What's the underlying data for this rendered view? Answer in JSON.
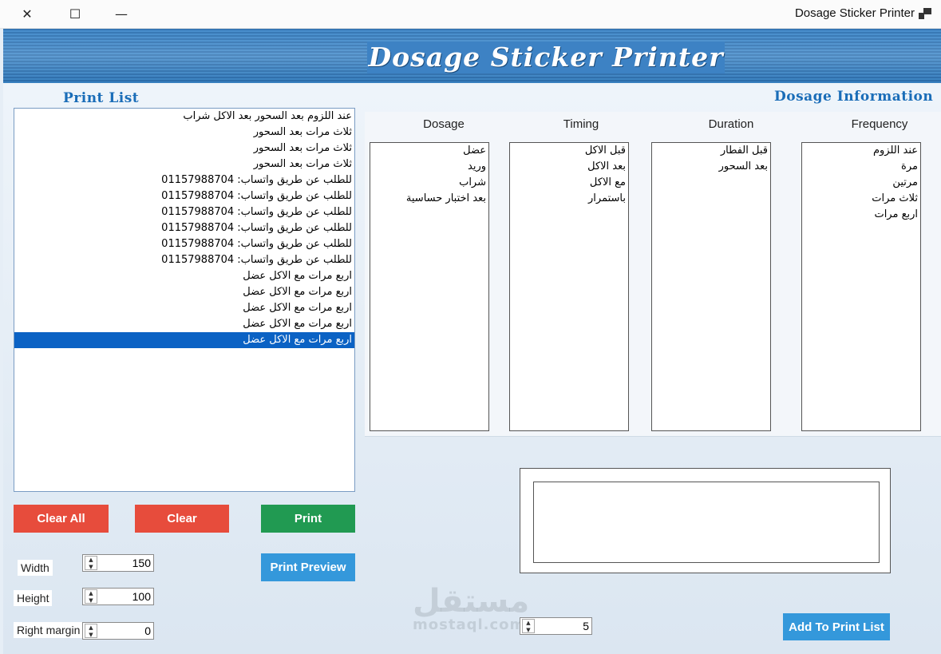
{
  "window": {
    "title": "Dosage Sticker Printer",
    "close_glyph": "✕",
    "maximize_glyph": "☐",
    "minimize_glyph": "—"
  },
  "banner": {
    "title": "Dosage Sticker Printer"
  },
  "print_list": {
    "title": "Print List",
    "items": [
      "عند اللزوم بعد السحور بعد الاكل  شراب",
      "ثلاث مرات بعد السحور",
      "ثلاث مرات بعد السحور",
      "ثلاث مرات بعد السحور",
      "للطلب عن طريق واتساب: 01157988704",
      "للطلب عن طريق واتساب: 01157988704",
      "للطلب عن طريق واتساب: 01157988704",
      "للطلب عن طريق واتساب: 01157988704",
      "للطلب عن طريق واتساب: 01157988704",
      "للطلب عن طريق واتساب: 01157988704",
      "اربع مرات مع الاكل  عضل",
      "اربع مرات مع الاكل  عضل",
      "اربع مرات مع الاكل  عضل",
      "اربع مرات مع الاكل  عضل",
      "اربع مرات مع الاكل  عضل"
    ],
    "selected_index": 14
  },
  "dosage_info": {
    "title": "Dosage Information",
    "columns": {
      "dosage": {
        "header": "Dosage",
        "items": [
          "عضل",
          "وريد",
          "شراب",
          "بعد اختبار حساسية"
        ]
      },
      "timing": {
        "header": "Timing",
        "items": [
          "قبل الاكل",
          "بعد الاكل",
          "مع الاكل",
          "باستمرار"
        ]
      },
      "duration": {
        "header": "Duration",
        "items": [
          "قبل الفطار",
          "بعد السحور"
        ]
      },
      "frequency": {
        "header": "Frequency",
        "items": [
          "عند اللزوم",
          "مرة",
          "مرتين",
          "ثلاث مرات",
          "اربع مرات"
        ]
      }
    }
  },
  "buttons": {
    "clear_all": "Clear All",
    "clear": "Clear",
    "print": "Print",
    "print_preview": "Print Preview",
    "add_to_print_list": "Add To Print List"
  },
  "settings": {
    "width_label": "Width",
    "width_value": "150",
    "height_label": "Height",
    "height_value": "100",
    "right_margin_label": "Right margin",
    "right_margin_value": "0"
  },
  "copies": {
    "value": "5"
  },
  "watermark": {
    "arabic": "مستقل",
    "latin": "mostaql.com"
  },
  "spin": {
    "up": "▲",
    "down": "▼"
  }
}
